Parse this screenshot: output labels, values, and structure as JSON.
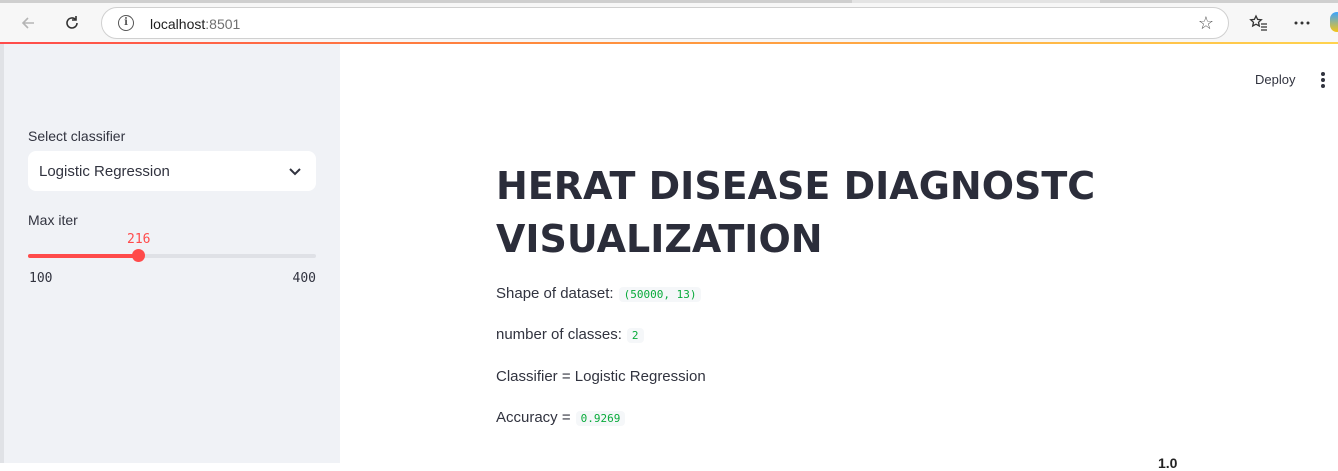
{
  "browser": {
    "url_host": "localhost",
    "url_port": ":8501"
  },
  "sidebar": {
    "classifier_label": "Select classifier",
    "classifier_value": "Logistic Regression",
    "slider_label": "Max iter",
    "slider_value": "216",
    "slider_min": "100",
    "slider_max": "400",
    "slider_fraction": 0.3867
  },
  "toolbar": {
    "deploy_label": "Deploy"
  },
  "main": {
    "title_line1": "HERAT DISEASE DIAGNOSTC",
    "title_line2": "VISUALIZATION",
    "shape_label": "Shape of dataset:",
    "shape_value": "(50000, 13)",
    "classes_label": "number of classes:",
    "classes_value": "2",
    "classifier_text": "Classifier = Logistic Regression",
    "accuracy_label": "Accuracy =",
    "accuracy_value": "0.9269",
    "peek_text": "1.0"
  },
  "colors": {
    "accent": "#ff4b4b",
    "code_text": "#09ab3b",
    "sidebar_bg": "#f0f2f6"
  }
}
